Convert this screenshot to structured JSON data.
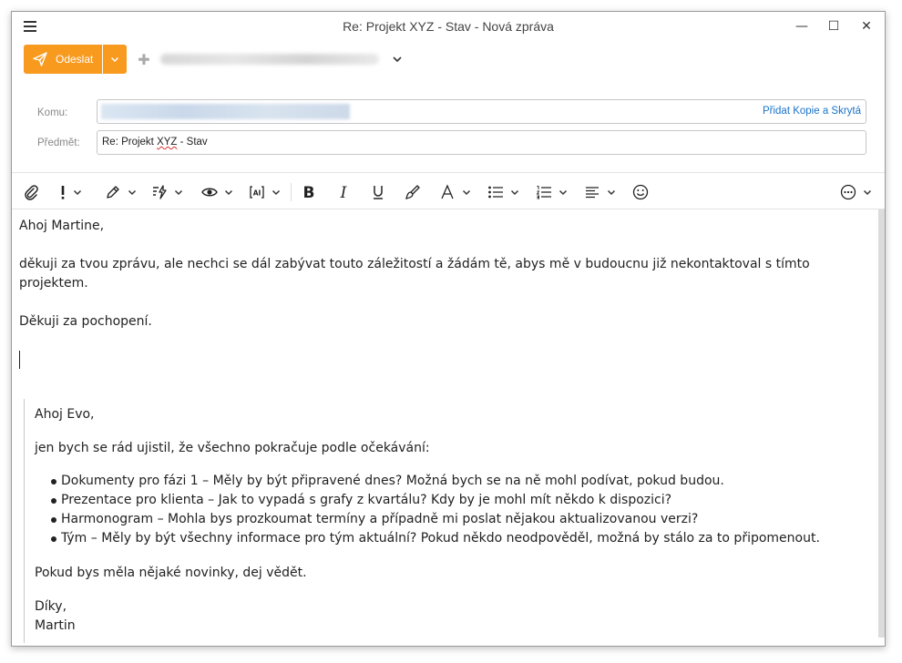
{
  "window": {
    "title": "Re: Projekt XYZ - Stav - Nová zpráva",
    "minimize": "—",
    "maximize": "☐",
    "close": "✕"
  },
  "toolbar": {
    "send_label": "Odeslat"
  },
  "fields": {
    "to_label": "Komu:",
    "cc_bcc_link": "Přidat Kopie a Skrytá",
    "subject_label": "Předmět:",
    "subject_prefix": "Re: Projekt ",
    "subject_highlight": "XYZ",
    "subject_suffix": " - Stav"
  },
  "message": {
    "greeting": "Ahoj Martine,",
    "paragraph1_line1": "děkuji za tvou zprávu, ale nechci se dál zabývat touto záležitostí a žádám tě, abys mě v budoucnu již nekontaktoval s tímto",
    "paragraph1_line2": "projektem.",
    "closing": "Děkuji za pochopení."
  },
  "quoted": {
    "greeting": "Ahoj Evo,",
    "intro": "jen bych se rád ujistil, že všechno pokračuje podle očekávání:",
    "items": [
      "Dokumenty pro fázi 1 – Měly by být připravené dnes? Možná bych se na ně mohl podívat, pokud budou.",
      "Prezentace pro klienta – Jak to vypadá s grafy z kvartálu? Kdy by je mohl mít někdo k dispozici?",
      "Harmonogram – Mohla bys prozkoumat termíny a případně mi poslat nějakou aktualizovanou verzi?",
      "Tým – Měly by být všechny informace pro tým aktuální? Pokud někdo neodpověděl, možná by stálo za to připomenout."
    ],
    "request": "Pokud bys měla nějaké novinky, dej vědět.",
    "signoff": "Díky,",
    "signature": "Martin"
  },
  "colors": {
    "accent": "#f79a1e",
    "link": "#1a73c9"
  }
}
